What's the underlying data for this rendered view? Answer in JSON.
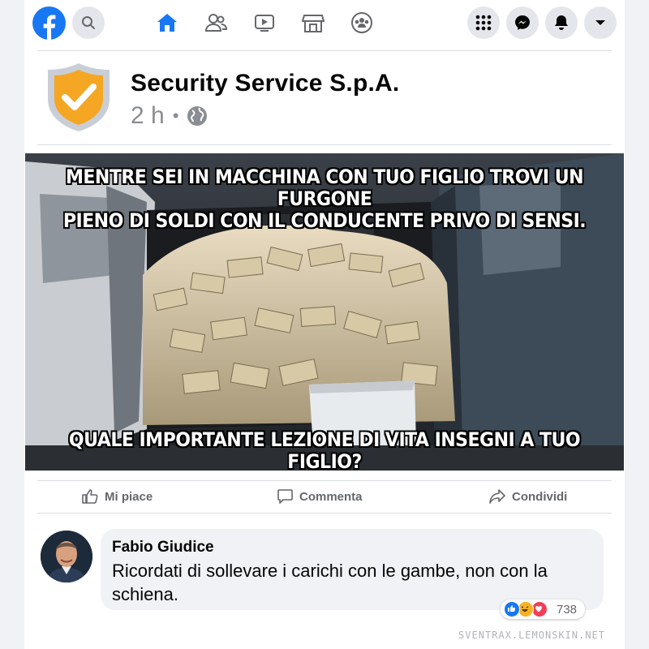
{
  "nav": {
    "logo": "facebook-logo",
    "icons": [
      "search-icon",
      "home-icon",
      "friends-icon",
      "watch-icon",
      "marketplace-icon",
      "groups-icon",
      "menu-grid-icon",
      "messenger-icon",
      "notifications-icon",
      "account-caret-icon"
    ],
    "accent_color": "#1877f2"
  },
  "post": {
    "page_name": "Security Service S.p.A.",
    "time": "2 h",
    "separator": "•",
    "privacy_icon": "globe-icon",
    "shield_colors": {
      "outer": "#c9ced6",
      "inner": "#f5a623"
    },
    "meme": {
      "top_caption_line1": "MENTRE SEI IN MACCHINA CON TUO FIGLIO TROVI UN FURGONE",
      "top_caption_line2": "PIENO DI SOLDI CON IL  CONDUCENTE PRIVO DI SENSI.",
      "bottom_caption": "QUALE IMPORTANTE LEZIONE DI VITA INSEGNI A TUO FIGLIO?"
    }
  },
  "actions": {
    "like": "Mi piace",
    "comment": "Commenta",
    "share": "Condividi"
  },
  "comment": {
    "author": "Fabio Giudice",
    "text": "Ricordati di sollevare i carichi con le gambe, non con la schiena.",
    "reactions": [
      "like",
      "haha",
      "love"
    ],
    "reaction_count": "738"
  },
  "watermark": "SVENTRAX.LEMONSKIN.NET"
}
